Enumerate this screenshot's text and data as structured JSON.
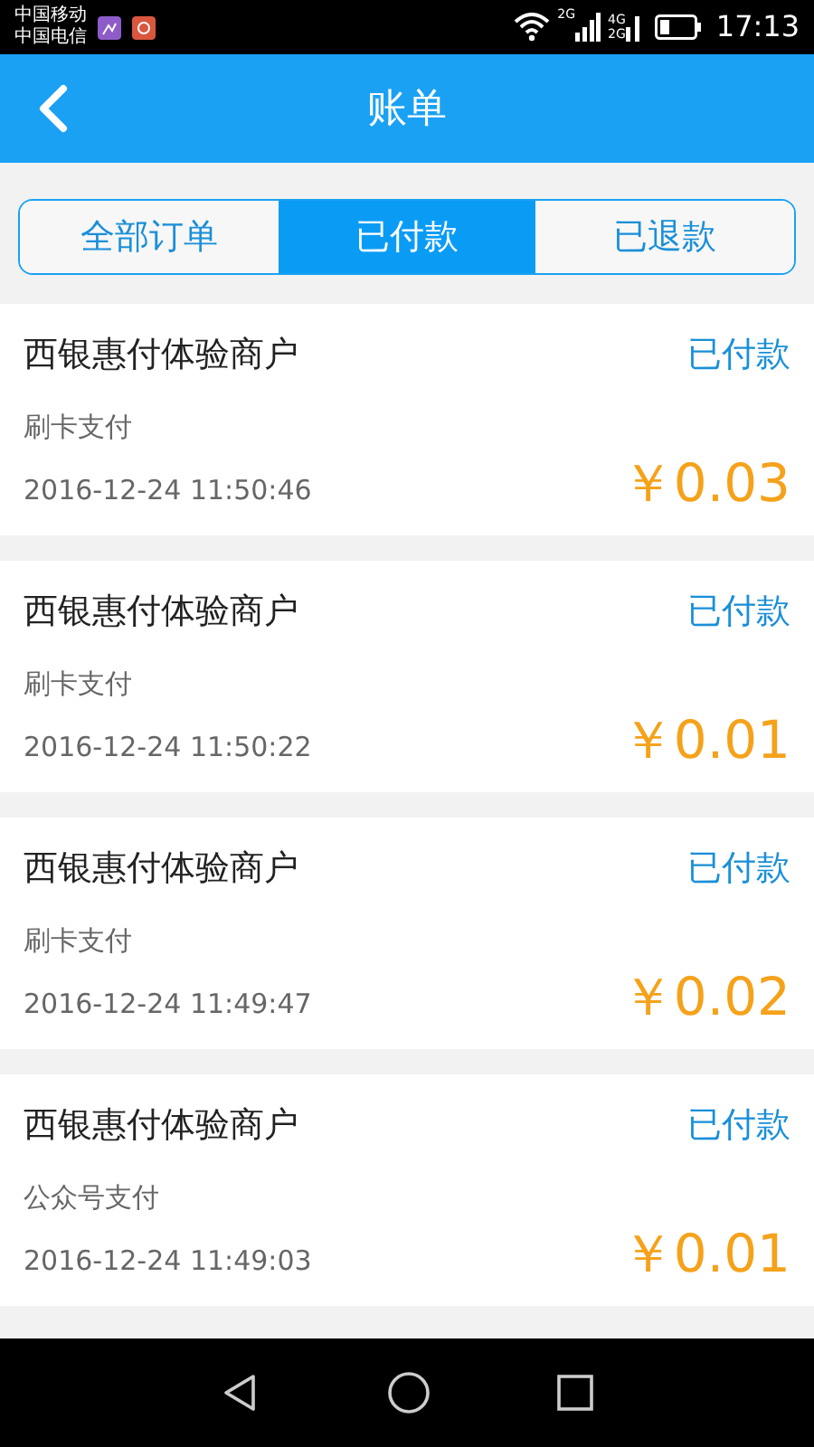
{
  "status_bar": {
    "carriers": [
      "中国移动",
      "中国电信"
    ],
    "network_labels": [
      "2G",
      "4G",
      "2G"
    ],
    "time": "17:13"
  },
  "header": {
    "title": "账单"
  },
  "tabs": [
    {
      "label": "全部订单",
      "selected": false
    },
    {
      "label": "已付款",
      "selected": true
    },
    {
      "label": "已退款",
      "selected": false
    }
  ],
  "bills": [
    {
      "merchant": "西银惠付体验商户",
      "status": "已付款",
      "method": "刷卡支付",
      "time": "2016-12-24 11:50:46",
      "amount": "￥0.03"
    },
    {
      "merchant": "西银惠付体验商户",
      "status": "已付款",
      "method": "刷卡支付",
      "time": "2016-12-24 11:50:22",
      "amount": "￥0.01"
    },
    {
      "merchant": "西银惠付体验商户",
      "status": "已付款",
      "method": "刷卡支付",
      "time": "2016-12-24 11:49:47",
      "amount": "￥0.02"
    },
    {
      "merchant": "西银惠付体验商户",
      "status": "已付款",
      "method": "公众号支付",
      "time": "2016-12-24 11:49:03",
      "amount": "￥0.01"
    }
  ]
}
